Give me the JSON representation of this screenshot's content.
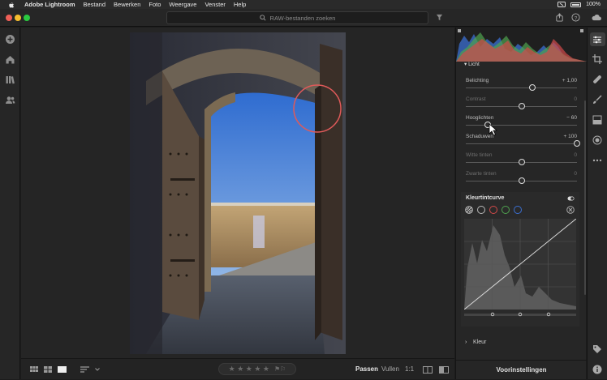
{
  "menubar": {
    "app": "Adobe Lightroom",
    "items": [
      "Bestand",
      "Bewerken",
      "Foto",
      "Weergave",
      "Venster",
      "Help"
    ],
    "battery": "100%"
  },
  "search": {
    "placeholder": "RAW-bestanden zoeken"
  },
  "sliders": [
    {
      "label": "Belichting",
      "value": "+ 1,00",
      "pos": 0.6,
      "dim": false
    },
    {
      "label": "Contrast",
      "value": "0",
      "pos": 0.5,
      "dim": true
    },
    {
      "label": "Hooglichten",
      "value": "− 60",
      "pos": 0.2,
      "dim": false
    },
    {
      "label": "Schaduwen",
      "value": "+ 100",
      "pos": 1.0,
      "dim": false
    },
    {
      "label": "Witte tinten",
      "value": "0",
      "pos": 0.5,
      "dim": true
    },
    {
      "label": "Zwarte tinten",
      "value": "0",
      "pos": 0.5,
      "dim": true
    }
  ],
  "panel": {
    "section_light": "Licht",
    "curve_title": "Kleurtintcurve",
    "kleur_label": "Kleur",
    "presets_label": "Voorinstellingen"
  },
  "bottombar": {
    "fit": "Passen",
    "fill": "Vullen",
    "ratio": "1:1",
    "stars": "★ ★ ★ ★ ★"
  },
  "colors": {
    "accent_red": "#e05a5a",
    "bg": "#1c1c1c",
    "panel": "#262626",
    "sky": "#3f77d0"
  },
  "icons": {
    "left": [
      "plus-icon",
      "home-icon",
      "library-icon",
      "people-icon"
    ],
    "right": [
      "edit-sliders-icon",
      "crop-icon",
      "healing-icon",
      "brush-icon",
      "gradient-icon",
      "radial-icon",
      "more-icon",
      "tag-icon",
      "info-icon"
    ]
  }
}
